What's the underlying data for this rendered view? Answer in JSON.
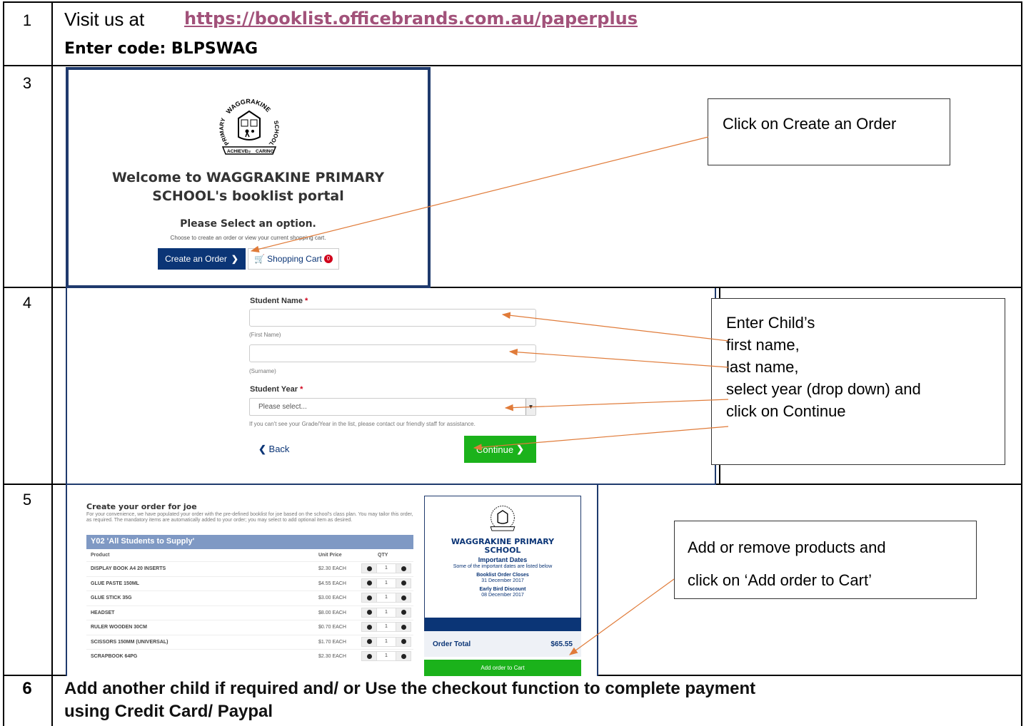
{
  "rows": {
    "r1": {
      "num": "1",
      "visit": "Visit us at",
      "url": "https://booklist.officebrands.com.au/paperplus",
      "code": "Enter code: BLPSWAG"
    },
    "r3": {
      "num": "3"
    },
    "r4": {
      "num": "4"
    },
    "r5": {
      "num": "5"
    },
    "r6": {
      "num": "6",
      "text_line1": "Add another child if required and/ or Use the checkout function to complete payment",
      "text_line2": "using Credit Card/ Paypal"
    }
  },
  "portal": {
    "welcome_line1": "Welcome to WAGGRAKINE PRIMARY",
    "welcome_line2": "SCHOOL's booklist portal",
    "select_option": "Please Select an option.",
    "choose_text": "Choose to create an order or view your current shopping cart.",
    "create_order_btn": "Create an Order",
    "shopping_cart_btn": "Shopping Cart",
    "cart_count": "0",
    "logo_text_top": "WAGGRAKINE",
    "logo_text_left": "PRIMARY",
    "logo_text_right": "SCHOOL",
    "logo_motto_left": "ACHIEVE",
    "logo_motto_mid": "by",
    "logo_motto_right": "CARING"
  },
  "callouts": {
    "create_order": "Click on Create an Order",
    "student_line1": "Enter Child’s",
    "student_line2": "first name,",
    "student_line3": "last name,",
    "student_line4": "select year (drop down) and",
    "student_line5": "click on Continue",
    "cart_line1": "Add or remove products and",
    "cart_line2": "click on ‘Add order to Cart’"
  },
  "student_form": {
    "name_label": "Student Name",
    "first_hint": "(First Name)",
    "surname_hint": "(Surname)",
    "year_label": "Student Year",
    "year_placeholder": "Please select...",
    "year_hint": "If you can't see your Grade/Year in the list, please contact our friendly staff for assistance.",
    "back_btn": "Back",
    "continue_btn": "Continue"
  },
  "order": {
    "title": "Create your order for joe",
    "description": "For your convenience, we have populated your order with the pre-defined booklist for joe based on the school's class plan. You may tailor this order, as required. The mandatory items are automatically added to your order; you may select to add optional item as desired.",
    "list_name": "Y02 'All Students to Supply'",
    "col_product": "Product",
    "col_price": "Unit Price",
    "col_qty": "QTY",
    "items": [
      {
        "name": "DISPLAY BOOK A4 20 INSERTS",
        "price": "$2.30 EACH",
        "qty": "1"
      },
      {
        "name": "GLUE PASTE 150ML",
        "price": "$4.55 EACH",
        "qty": "1"
      },
      {
        "name": "GLUE STICK 35G",
        "price": "$3.00 EACH",
        "qty": "1"
      },
      {
        "name": "HEADSET",
        "price": "$8.00 EACH",
        "qty": "1"
      },
      {
        "name": "RULER WOODEN 30CM",
        "price": "$0.70 EACH",
        "qty": "1"
      },
      {
        "name": "SCISSORS 150MM (UNIVERSAL)",
        "price": "$1.70 EACH",
        "qty": "1"
      },
      {
        "name": "SCRAPBOOK 64PG",
        "price": "$2.30 EACH",
        "qty": "1"
      }
    ],
    "school_line1": "WAGGRAKINE PRIMARY",
    "school_line2": "SCHOOL",
    "important_dates": "Important Dates",
    "dates_intro": "Some of the important dates are listed below",
    "closes_label": "Booklist Order Closes",
    "closes_date": "31 December 2017",
    "early_label": "Early Bird Discount",
    "early_date": "08 December 2017",
    "total_label": "Order Total",
    "total_value": "$65.55",
    "add_btn": "Add order to Cart"
  },
  "colors": {
    "navy": "#0b3576",
    "green": "#1bb21b",
    "arrow": "#e07b39",
    "link": "#a2527a",
    "band": "#7f99c4"
  }
}
